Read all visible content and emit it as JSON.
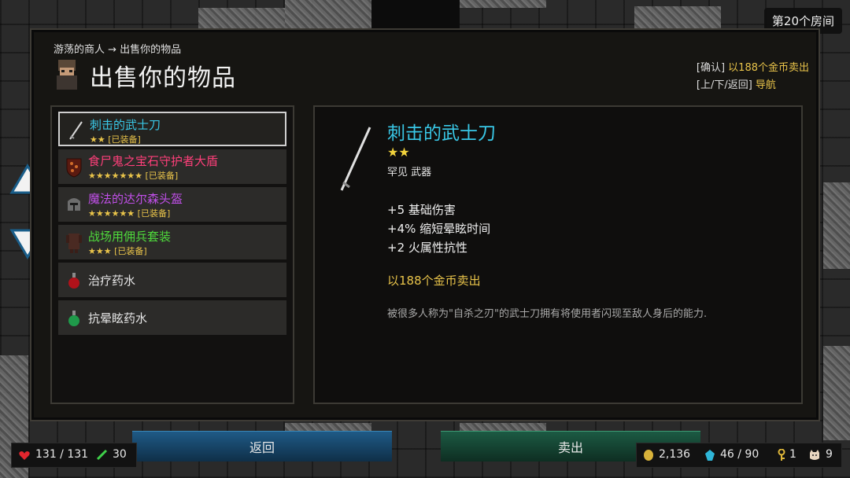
{
  "room_label": "第20个房间",
  "panel": {
    "breadcrumb": "游荡的商人 → 出售你的物品",
    "title": "出售你的物品",
    "hint_confirm_key": "[确认]",
    "hint_confirm_action": "以188个金币卖出",
    "hint_nav_key": "[上/下/返回]",
    "hint_nav_action": "导航"
  },
  "items": [
    {
      "name": "刺击的武士刀",
      "stars": "★★",
      "equipped": "[已装备]",
      "color": "#39c7e6",
      "icon": "katana-icon",
      "selected": true
    },
    {
      "name": "食尸鬼之宝石守护者大盾",
      "stars": "★★★★★★★",
      "equipped": "[已装备]",
      "color": "#ff3f7a",
      "icon": "shield-icon"
    },
    {
      "name": "魔法的达尔森头盔",
      "stars": "★★★★★★",
      "equipped": "[已装备]",
      "color": "#c04fe8",
      "icon": "helmet-icon"
    },
    {
      "name": "战场用佣兵套装",
      "stars": "★★★",
      "equipped": "[已装备]",
      "color": "#4fdc3c",
      "icon": "armor-icon"
    },
    {
      "name": "治疗药水",
      "stars": "",
      "equipped": "",
      "color": "#f0f0f0",
      "icon": "red-potion-icon"
    },
    {
      "name": "抗晕眩药水",
      "stars": "",
      "equipped": "",
      "color": "#f0f0f0",
      "icon": "green-potion-icon"
    }
  ],
  "detail": {
    "name": "刺击的武士刀",
    "stars": "★★",
    "type": "罕见 武器",
    "stats": [
      "+5 基础伤害",
      "+4% 缩短晕眩时间",
      "+2 火属性抗性"
    ],
    "price": "以188个金币卖出",
    "description": "被很多人称为\"自杀之刃\"的武士刀拥有将使用者闪现至敌人身后的能力."
  },
  "buttons": {
    "back": "返回",
    "sell": "卖出"
  },
  "hud": {
    "health": "131 / 131",
    "attack": "30",
    "gold": "2,136",
    "mana": "46 / 90",
    "keys": "1",
    "pets": "9"
  },
  "colors": {
    "accent_gold": "#e9c44a",
    "item_cyan": "#39c7e6"
  }
}
